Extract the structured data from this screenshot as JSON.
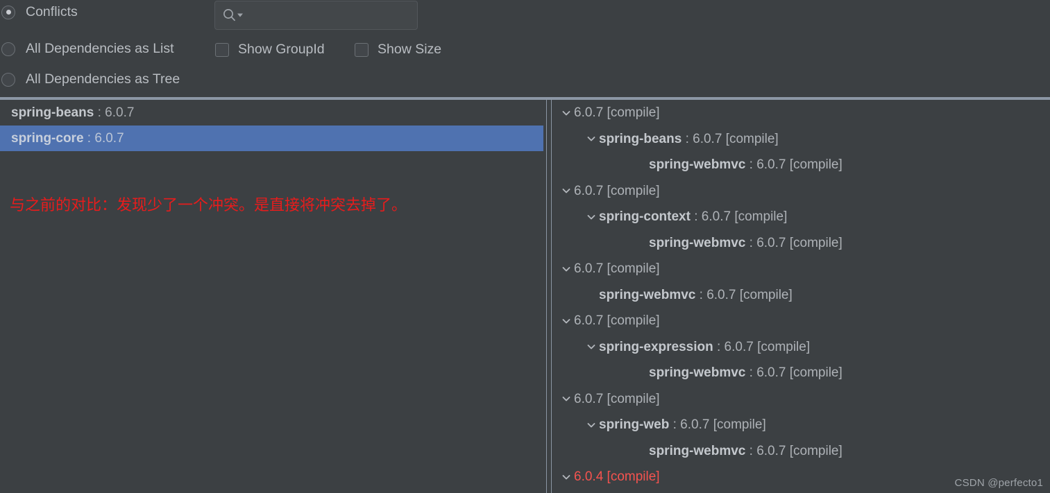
{
  "toolbar": {
    "radios": [
      {
        "label": "Conflicts",
        "checked": true
      },
      {
        "label": "All Dependencies as List",
        "checked": false
      },
      {
        "label": "All Dependencies as Tree",
        "checked": false
      }
    ],
    "checkboxes": [
      {
        "label": "Show GroupId",
        "checked": false
      },
      {
        "label": "Show Size",
        "checked": false
      }
    ],
    "search": {
      "value": "",
      "placeholder": "",
      "icon": "search-icon",
      "dropdown_icon": "caret-down-icon"
    }
  },
  "left_panel": {
    "rows": [
      {
        "artifact": "spring-beans",
        "separator": ":",
        "version": "6.0.7",
        "selected": false
      },
      {
        "artifact": "spring-core",
        "separator": ":",
        "version": "6.0.7",
        "selected": true
      }
    ],
    "annotation": "与之前的对比：发现少了一个冲突。是直接将冲突去掉了。",
    "annotation_color": "#e81c1c"
  },
  "right_panel": {
    "rows": [
      {
        "indent": 0,
        "chevron": "chevron-down-icon",
        "artifact": "",
        "text": "6.0.7 [compile]",
        "red": false
      },
      {
        "indent": 1,
        "chevron": "chevron-down-icon",
        "artifact": "spring-beans",
        "text": " : 6.0.7 [compile]",
        "red": false
      },
      {
        "indent": 2,
        "chevron": "",
        "artifact": "spring-webmvc",
        "text": " : 6.0.7 [compile]",
        "red": false
      },
      {
        "indent": 0,
        "chevron": "chevron-down-icon",
        "artifact": "",
        "text": "6.0.7 [compile]",
        "red": false
      },
      {
        "indent": 1,
        "chevron": "chevron-down-icon",
        "artifact": "spring-context",
        "text": " : 6.0.7 [compile]",
        "red": false
      },
      {
        "indent": 2,
        "chevron": "",
        "artifact": "spring-webmvc",
        "text": " : 6.0.7 [compile]",
        "red": false
      },
      {
        "indent": 0,
        "chevron": "chevron-down-icon",
        "artifact": "",
        "text": "6.0.7 [compile]",
        "red": false
      },
      {
        "indent": 1,
        "chevron": "",
        "artifact": "spring-webmvc",
        "text": " : 6.0.7 [compile]",
        "red": false
      },
      {
        "indent": 0,
        "chevron": "chevron-down-icon",
        "artifact": "",
        "text": "6.0.7 [compile]",
        "red": false
      },
      {
        "indent": 1,
        "chevron": "chevron-down-icon",
        "artifact": "spring-expression",
        "text": " : 6.0.7 [compile]",
        "red": false
      },
      {
        "indent": 2,
        "chevron": "",
        "artifact": "spring-webmvc",
        "text": " : 6.0.7 [compile]",
        "red": false
      },
      {
        "indent": 0,
        "chevron": "chevron-down-icon",
        "artifact": "",
        "text": "6.0.7 [compile]",
        "red": false
      },
      {
        "indent": 1,
        "chevron": "chevron-down-icon",
        "artifact": "spring-web",
        "text": " : 6.0.7 [compile]",
        "red": false
      },
      {
        "indent": 2,
        "chevron": "",
        "artifact": "spring-webmvc",
        "text": " : 6.0.7 [compile]",
        "red": false
      },
      {
        "indent": 0,
        "chevron": "chevron-down-icon",
        "artifact": "",
        "text": "6.0.4 [compile]",
        "red": true
      }
    ]
  },
  "watermark": "CSDN @perfecto1",
  "colors": {
    "background": "#3c4043",
    "selection": "#4f72b0",
    "border": "#8c97a5",
    "text": "#b9bdc2",
    "conflict_red": "#f5534f",
    "annotation_red": "#e81c1c"
  }
}
